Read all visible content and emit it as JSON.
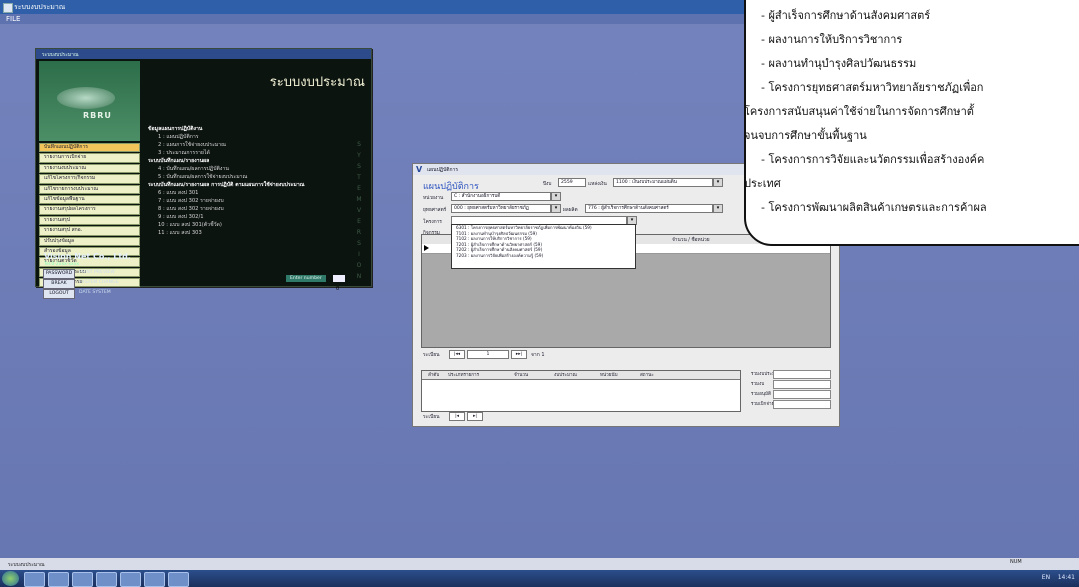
{
  "app": {
    "title": "ระบบงบประมาณ",
    "menu_file": "FILE"
  },
  "left_window": {
    "caption": "ระบบงบประมาณ",
    "logo_text": "RBRU",
    "system_name": "ระบบงบประมาณ",
    "sidebar": [
      "บันทึกแผนปฏิบัติการ",
      "รายงานการเบิกจ่าย",
      "รายงานงบประมาณ",
      "แก้ไขโครงการ/กิจกรรม",
      "แก้ไขรายการงบประมาณ",
      "แก้ไขข้อมูลพื้นฐาน",
      "รายงานสรุปผลโครงการ",
      "รายงานสรุป",
      "รายงานสรุป สกอ.",
      "ปรับปรุงข้อมูล",
      "สำรองข้อมูล",
      "รายงานตัวชี้วัด",
      "ข้อมูลผู้ใช้งานระบบ",
      "ออกจากโปรแกรม"
    ],
    "vision_title": "Vision Net Co., Ltd.",
    "vision_sub": "Tel.0-2xxx-xxxx",
    "buttons": {
      "password": "PASSWORD",
      "break": "BREAK",
      "logout": "LOGOUT"
    },
    "checks": {
      "print_preview": "PRINT PREVIEW",
      "system_check": "SYSTEM CHANGE",
      "date": "DATE SYSTEM"
    },
    "main_lines": [
      {
        "text": "ข้อมูลแผนการปฏิบัติงาน",
        "kind": "hd"
      },
      {
        "text": "1 : แผนปฏิบัติการ",
        "kind": "ind"
      },
      {
        "text": "2 : แผนการใช้จ่ายงบประมาณ",
        "kind": "ind"
      },
      {
        "text": "3 : ประมาณการรายได้",
        "kind": "ind"
      },
      {
        "text": "ระบบบันทึกแผน/รายงานผล",
        "kind": "hd"
      },
      {
        "text": "4 : บันทึกแผน/ผลการปฏิบัติงาน",
        "kind": "ind"
      },
      {
        "text": "5 : บันทึกแผน/ผลการใช้จ่ายงบประมาณ",
        "kind": "ind"
      },
      {
        "text": "ระบบบันทึกแผน/รายงานผล การปฏิบัติ ตามแผนการใช้จ่ายงบประมาณ",
        "kind": "hd"
      },
      {
        "text": "6 : แบบ สงป 301",
        "kind": "ind"
      },
      {
        "text": "7 : แบบ สงป 302 รายจ่ายงบ",
        "kind": "ind"
      },
      {
        "text": "8 : แบบ สงป 302 รายจ่ายงบ",
        "kind": "ind"
      },
      {
        "text": "9 : แบบ สงป 302/1",
        "kind": "ind"
      },
      {
        "text": "10 : แบบ สงป 301(ตัวชี้วัด)",
        "kind": "ind"
      },
      {
        "text": "11 : แบบ สงป 303",
        "kind": "ind"
      }
    ],
    "enter_label": "Enter number",
    "enter_value": "0"
  },
  "middle_window": {
    "caption": "แผนปฏิบัติการ",
    "form_title": "แผนปฏิบัติการ",
    "year_label": "ปีงบ",
    "year_value": "2559",
    "agency_label": "หน่วยงาน",
    "agency_value": "C : สำนักงานอธิการบดี",
    "cost_label": "แหล่งเงิน",
    "cost_value": "1100 : เงินงบประมาณแผ่นดิน",
    "strat_label": "ยุทธศาสตร์",
    "strat_value": "000 : ยุทธศาสตร์มหาวิทยาลัยราชภัฏ",
    "plan_label": "ผลผลิต",
    "plan_value": "776 : ผู้สำเร็จการศึกษาด้านสังคมศาสตร์",
    "proj_label": "โครงการ",
    "act_label": "กิจกรรม",
    "col_amount": "จำนวน / ชื่อหน่วย",
    "popup_items": [
      "6301 : โครงการยุทธศาสตร์มหาวิทยาลัยราชภัฏเพื่อการพัฒนาท้องถิ่น (59)",
      "7101 : ผลงานทำนุบำรุงศิลปวัฒนธรรม (59)",
      "7102 : ผลงานการให้บริการวิชาการ (59)",
      "7201 : ผู้สำเร็จการศึกษาด้านวิทยาศาสตร์ (59)",
      "7202 : ผู้สำเร็จการศึกษาด้านสังคมศาสตร์ (59)",
      "7203 : ผลงานการวิจัยเพื่อสร้างองค์ความรู้ (59)"
    ],
    "nav_label": "ระเบียน",
    "nav_of": "จาก 1",
    "nav_pos": "1",
    "low_cols": [
      "ลำดับ",
      "ประเภทรายการ",
      "จำนวน",
      "งบประมาณ",
      "หน่วยนับ",
      "สถานะ"
    ],
    "right_labels": [
      "รวมงบประมาณ",
      "รวมงบ",
      "รวมอนุมัติ",
      "รวมเบิกจ่าย"
    ]
  },
  "bubble_lines": [
    "- ผู้สำเร็จการศึกษาด้านสังคมศาสตร์",
    "- ผลงานการให้บริการวิชาการ",
    "- ผลงานทำนุบำรุงศิลปวัฒนธรรม",
    "- โครงการยุทธศาสตร์มหาวิทยาลัยราชภัฏเพื่อก",
    "โครงการสนับสนุนค่าใช้จ่ายในการจัดการศึกษาตั้",
    "จนจบการศึกษาขั้นพื้นฐาน",
    "- โครงการการวิจัยและนวัตกรรมเพื่อสร้างองค์ค",
    "ประเทศ",
    "- โครงการพัฒนาผลิตสินค้าเกษตรและการค้าผล"
  ],
  "status_bar": {
    "left": "ระบบงบประมาณ",
    "num": "NUM"
  },
  "taskbar": {
    "time": "14:41",
    "lang": "EN"
  }
}
